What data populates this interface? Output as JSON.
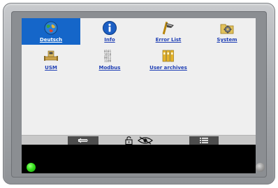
{
  "menu": {
    "items": [
      {
        "label": "Deutsch",
        "icon": "globe-icon",
        "selected": true
      },
      {
        "label": "Info",
        "icon": "info-icon",
        "selected": false
      },
      {
        "label": "Error List",
        "icon": "error-list-icon",
        "selected": false
      },
      {
        "label": "System",
        "icon": "system-gear-icon",
        "selected": false
      },
      {
        "label": "USM",
        "icon": "usm-meter-icon",
        "selected": false
      },
      {
        "label": "Modbus",
        "icon": "modbus-binary-icon",
        "selected": false
      },
      {
        "label": "User archives",
        "icon": "archive-binders-icon",
        "selected": false
      }
    ]
  },
  "toolbar": {
    "back": "back-arrow-icon",
    "lock": "unlock-icon",
    "visibility": "eye-hidden-icon",
    "list": "list-icon"
  },
  "leds": {
    "left": {
      "color": "#35e21c",
      "state": "on"
    },
    "right": {
      "color": "#9b9b9b",
      "state": "off"
    }
  },
  "colors": {
    "selected_tile": "#1566c9",
    "link_text": "#1f3fb5",
    "screen_bg": "#efefef",
    "toolbar_bg": "#c8c8c8"
  }
}
